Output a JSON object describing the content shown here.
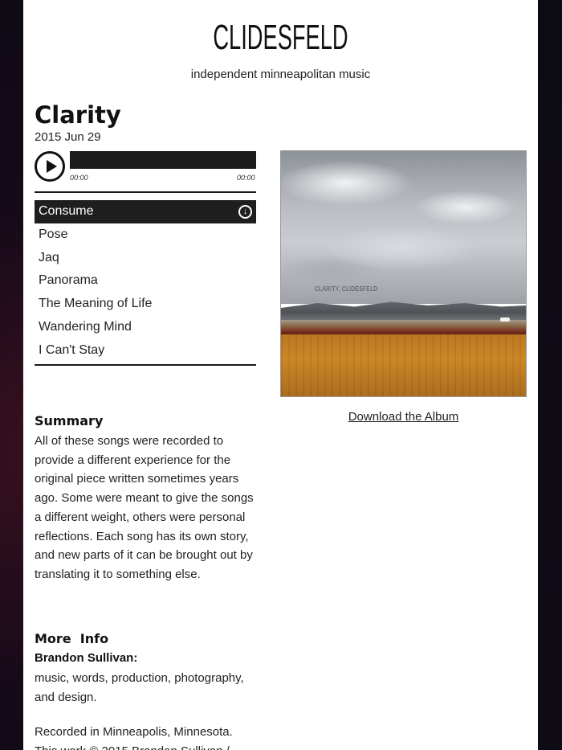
{
  "site": {
    "title": "CLIDESFELD",
    "subtitle": "independent minneapolitan music"
  },
  "album": {
    "title": "Clarity",
    "date": "2015 Jun 29",
    "cover_caption": "CLARITY, CLIDESFELD",
    "download_label": "Download the Album"
  },
  "player": {
    "time_elapsed": "00:00",
    "time_total": "00:00",
    "progress": 0
  },
  "tracks": [
    {
      "label": "Consume",
      "active": true
    },
    {
      "label": "Pose"
    },
    {
      "label": "Jaq"
    },
    {
      "label": "Panorama"
    },
    {
      "label": "The Meaning of Life"
    },
    {
      "label": "Wandering Mind"
    },
    {
      "label": "I Can't Stay"
    }
  ],
  "summary": {
    "heading": "Summary",
    "text": "All of these songs were recorded to provide a different experience for the original piece written sometimes years ago. Some were meant to give the songs a different weight, others were personal reflections. Each song has its own story, and new parts of it can be brought out by translating it to something else."
  },
  "more_info": {
    "heading": "More  Info",
    "credit_name": "Brandon Sullivan:",
    "credit_roles": "music, words, production, photography, and design.",
    "recorded": "Recorded in Minneapolis, Minnesota.",
    "copyright": "This work © 2015 Brandon Sullivan /"
  },
  "colors": {
    "page_bg": "#ffffff",
    "active_track_bg": "#1e1e1e",
    "text": "#222222"
  },
  "icons": {
    "play": "play-icon",
    "download_track": "download-circle-icon"
  }
}
